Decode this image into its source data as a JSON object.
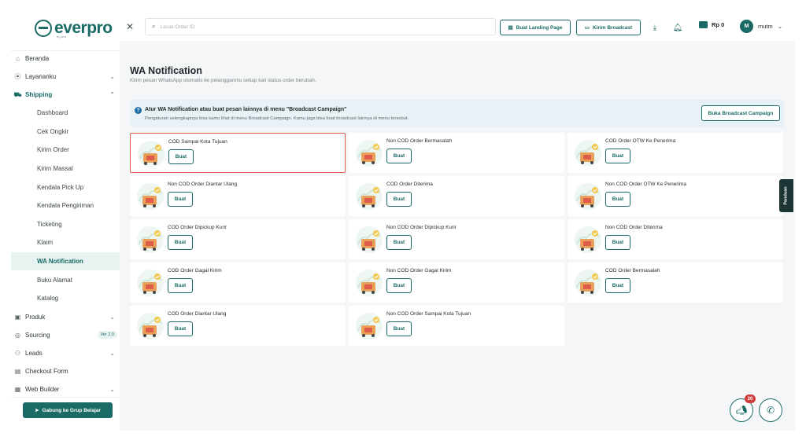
{
  "brand": {
    "logo_text": "everpro",
    "logo_sub": "by kmt"
  },
  "search": {
    "placeholder": "Lacak Order ID"
  },
  "topbar": {
    "landing_label": "Buat Landing Page",
    "broadcast_label": "Kirim Broadcast",
    "balance": "Rp 0",
    "user_initial": "M",
    "user_name": "mutm"
  },
  "nav": {
    "beranda": "Beranda",
    "layananku": "Layananku",
    "shipping": "Shipping",
    "shipping_items": [
      "Dashboard",
      "Cek Ongkir",
      "Kirim Order",
      "Kirim Massal",
      "Kendala Pick Up",
      "Kendala Pengiriman",
      "Ticketing",
      "Klaim",
      "WA Notification",
      "Buku Alamat",
      "Katalog"
    ],
    "produk": "Produk",
    "sourcing": "Sourcing",
    "sourcing_badge": "Ver 2.0",
    "leads": "Leads",
    "checkout": "Checkout Form",
    "webbuilder": "Web Builder",
    "join_label": "Gabung ke Grup Belajar"
  },
  "page": {
    "title": "WA Notification",
    "subtitle": "Kirim pesan WhatsApp otomatis ke pelangganmu setiap kali status order berubah."
  },
  "info": {
    "title": "Atur WA Notification atau buat pesan lainnya di menu \"Broadcast Campaign\"",
    "desc": "Pengaturan selengkapnya bisa kamu lihat di menu Broadcast Campaign. Kamu juga bisa buat broadcast lainnya di menu tersebut.",
    "button": "Buka Broadcast Campaign"
  },
  "cards": [
    {
      "title": "COD Sampai Kota Tujuan",
      "button": "Buat"
    },
    {
      "title": "Non COD Order Bermasalah",
      "button": "Buat"
    },
    {
      "title": "COD Order OTW Ke Penerima",
      "button": "Buat"
    },
    {
      "title": "Non COD Order Diantar Ulang",
      "button": "Buat"
    },
    {
      "title": "COD Order Diterima",
      "button": "Buat"
    },
    {
      "title": "Non COD Order OTW Ke Penerima",
      "button": "Buat"
    },
    {
      "title": "COD Order Dipickup Kurir",
      "button": "Buat"
    },
    {
      "title": "Non COD Order Dipickup Kurir",
      "button": "Buat"
    },
    {
      "title": "Non COD Order Diterima",
      "button": "Buat"
    },
    {
      "title": "COD Order Gagal Kirim",
      "button": "Buat"
    },
    {
      "title": "Non COD Order Gagal Kirim",
      "button": "Buat"
    },
    {
      "title": "COD Order Bermasalah",
      "button": "Buat"
    },
    {
      "title": "COD Order Diantar Ulang",
      "button": "Buat"
    },
    {
      "title": "Non COD Order Sampai Kota Tujuan",
      "button": "Buat"
    }
  ],
  "panduan": "Panduan",
  "notif_count": "20",
  "colors": {
    "accent": "#1a6b65",
    "highlight": "#e05c4a",
    "info_bg": "#e8f1f5"
  }
}
